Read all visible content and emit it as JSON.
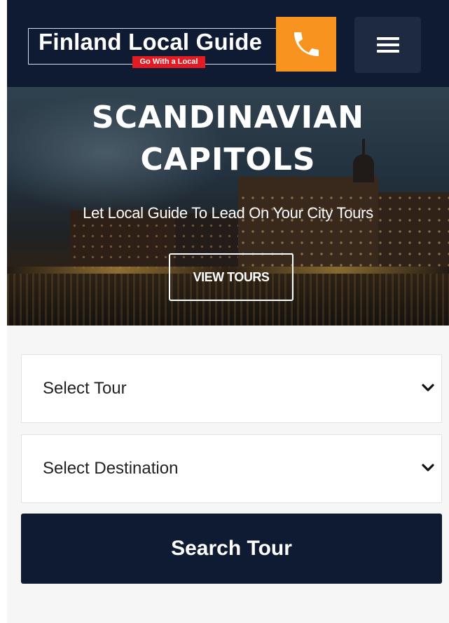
{
  "header": {
    "logo_text": "Finland Local Guide",
    "logo_tagline": "Go With a Local",
    "phone_icon": "phone-icon",
    "menu_icon": "hamburger-menu-icon"
  },
  "hero": {
    "title_line1": "SCANDINAVIAN",
    "title_line2": "CAPITOLS",
    "subtitle": "Let Local Guide To Lead On Your City Tours",
    "cta_label": "VIEW TOURS"
  },
  "search": {
    "tour_select": {
      "selected": "Select Tour"
    },
    "destination_select": {
      "selected": "Select Destination"
    },
    "submit_label": "Search Tour"
  },
  "colors": {
    "header_bg": "#0f1b33",
    "accent_orange": "#f7931e",
    "tagline_red": "#e31b23",
    "search_button_bg": "#0f1b33"
  }
}
